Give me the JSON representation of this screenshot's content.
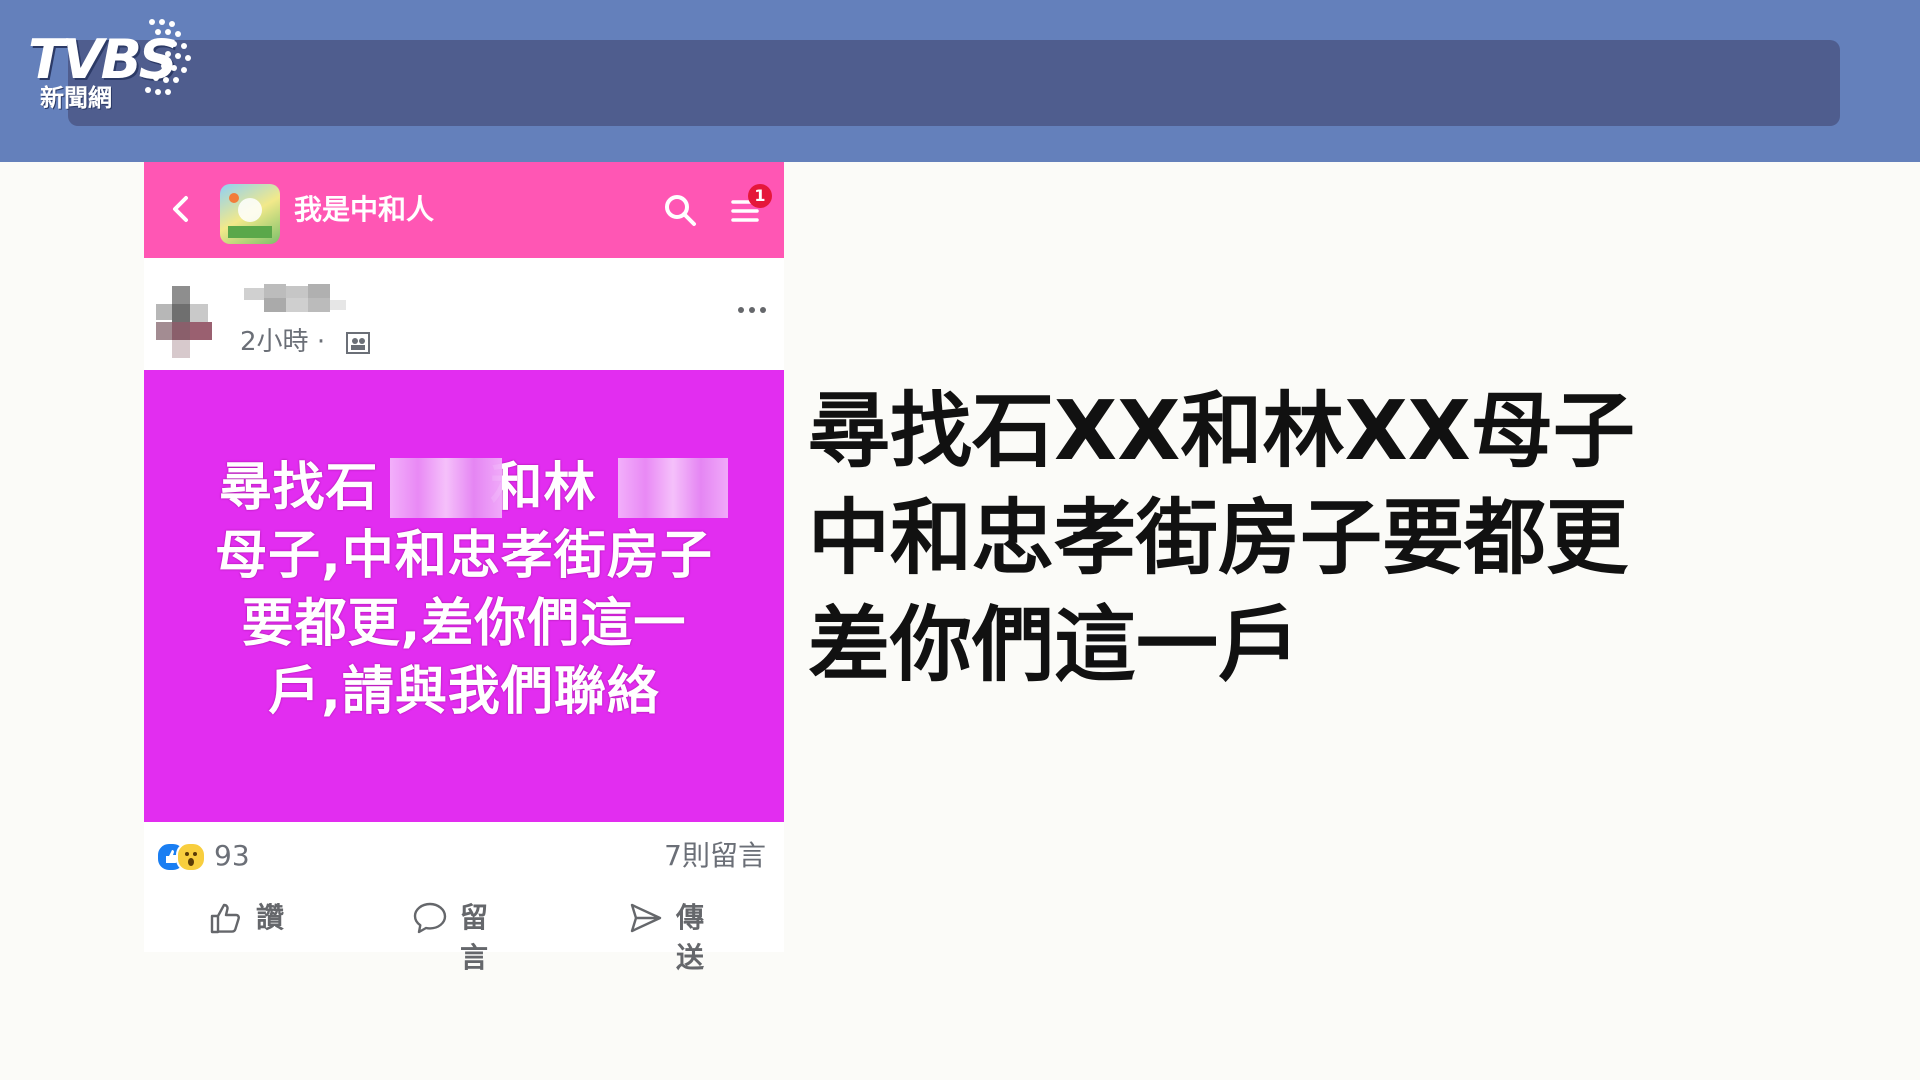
{
  "logo": {
    "main": "TVBS",
    "sub": "新聞網"
  },
  "facebook": {
    "group_name": "我是中和人",
    "notification_count": "1",
    "post": {
      "time": "2小時",
      "separator": "·",
      "image_text": {
        "line1a": "尋找石",
        "line1b": "和林",
        "line2": "母子,中和忠孝街房子",
        "line3": "要都更,差你們這一",
        "line4": "戶,請與我們聯絡"
      },
      "reaction_count": "93",
      "comment_count": "7則留言"
    },
    "actions": {
      "like": "讚",
      "comment": "留言",
      "share": "傳送"
    }
  },
  "caption": {
    "line1": "尋找石XX和林XX母子",
    "line2": "中和忠孝街房子要都更",
    "line3": "差你們這一戶"
  },
  "colors": {
    "header_bar": "#6480bb",
    "group_header": "#ff56b4",
    "post_image_bg": "#e22df0"
  }
}
